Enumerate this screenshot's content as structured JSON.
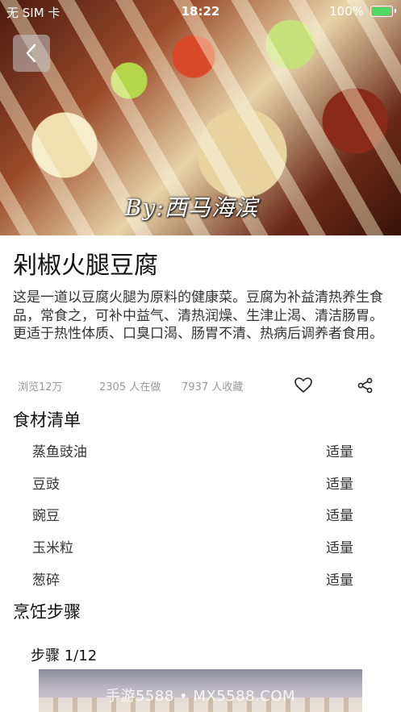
{
  "status_bar": {
    "carrier": "无 SIM 卡",
    "time": "18:22",
    "battery": "100%",
    "battery_level": 1.0
  },
  "hero": {
    "watermark": "By:西马海滨"
  },
  "recipe": {
    "title": "剁椒火腿豆腐",
    "description": "这是一道以豆腐火腿为原料的健康菜。豆腐为补益清热养生食品，常食之，可补中益气、清热润燥、生津止渴、清洁肠胃。更适于热性体质、口臭口渴、肠胃不清、热病后调养者食用。",
    "views": "浏览12万",
    "cooking": "2305 人在做",
    "favorites": "7937 人收藏"
  },
  "ingredients": {
    "heading": "食材清单",
    "items": [
      {
        "name": "蒸鱼豉油",
        "amount": "适量"
      },
      {
        "name": "豆豉",
        "amount": "适量"
      },
      {
        "name": "豌豆",
        "amount": "适量"
      },
      {
        "name": "玉米粒",
        "amount": "适量"
      },
      {
        "name": "葱碎",
        "amount": "适量"
      }
    ]
  },
  "steps": {
    "heading": "烹饪步骤",
    "current_label": "步骤 1/12"
  },
  "watermark_bottom": "手游5588 • MX5588.COM",
  "colors": {
    "battery_green": "#4cd964",
    "text_primary": "#111111",
    "text_muted": "#999999"
  }
}
